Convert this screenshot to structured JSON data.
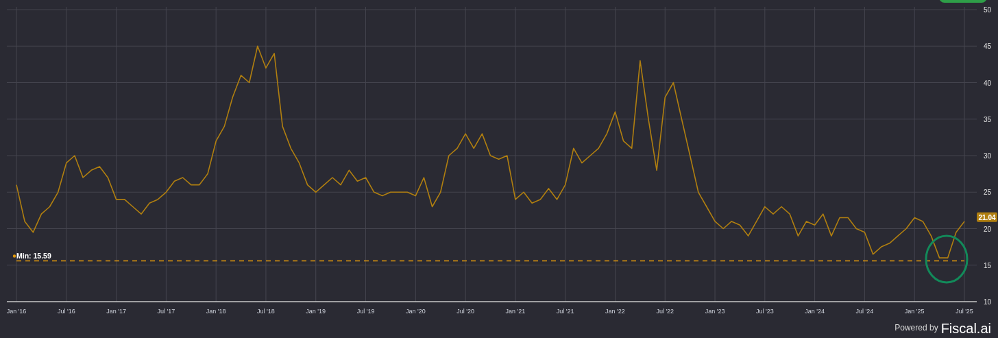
{
  "chart_data": {
    "type": "line",
    "categories": [
      "Jan '16",
      null,
      null,
      null,
      null,
      null,
      "Jul '16",
      null,
      null,
      null,
      null,
      null,
      "Jan '17",
      null,
      null,
      null,
      null,
      null,
      "Jul '17",
      null,
      null,
      null,
      null,
      null,
      "Jan '18",
      null,
      null,
      null,
      null,
      null,
      "Jul '18",
      null,
      null,
      null,
      null,
      null,
      "Jan '19",
      null,
      null,
      null,
      null,
      null,
      "Jul '19",
      null,
      null,
      null,
      null,
      null,
      "Jan '20",
      null,
      null,
      null,
      null,
      null,
      "Jul '20",
      null,
      null,
      null,
      null,
      null,
      "Jan '21",
      null,
      null,
      null,
      null,
      null,
      "Jul '21",
      null,
      null,
      null,
      null,
      null,
      "Jan '22",
      null,
      null,
      null,
      null,
      null,
      "Jul '22",
      null,
      null,
      null,
      null,
      null,
      "Jan '23",
      null,
      null,
      null,
      null,
      null,
      "Jul '23",
      null,
      null,
      null,
      null,
      null,
      "Jan '24",
      null,
      null,
      null,
      null,
      null,
      "Jul '24",
      null,
      null,
      null,
      null,
      null,
      "Jan '25",
      null,
      null,
      null,
      null,
      null,
      "Jul '25"
    ],
    "series": [
      {
        "color": "#b07f10",
        "values": [
          26,
          21,
          19.5,
          22,
          23,
          25,
          29,
          30,
          27,
          28,
          28.5,
          27,
          24,
          24,
          23,
          22,
          23.5,
          24,
          25,
          26.5,
          27,
          26,
          26,
          27.5,
          32,
          34,
          38,
          41,
          40,
          45,
          42,
          44,
          34,
          31,
          29,
          26,
          25,
          26,
          27,
          26,
          28,
          26.5,
          27,
          25,
          24.5,
          25,
          25,
          25,
          24.5,
          27,
          23,
          25,
          30,
          31,
          33,
          31,
          33,
          30,
          29.5,
          30,
          24,
          25,
          23.5,
          24,
          25.5,
          24,
          26,
          31,
          29,
          30,
          31,
          33,
          36,
          32,
          31,
          43,
          35,
          28,
          38,
          40,
          35,
          30,
          25,
          23,
          21,
          20,
          21,
          20.5,
          19,
          21,
          23,
          22,
          23,
          22,
          19,
          21,
          20.5,
          22,
          19,
          21.5,
          21.5,
          20,
          19.5,
          16.5,
          17.5,
          18,
          19,
          20,
          21.5,
          21,
          19,
          16,
          16,
          19.5,
          21
        ]
      },
      {
        "name": "Min: 15.59",
        "color": "#e0980c",
        "line_style": "dashed",
        "values": [
          15.59,
          15.59,
          15.59,
          15.59,
          15.59,
          15.59,
          15.59,
          15.59,
          15.59,
          15.59,
          15.59,
          15.59,
          15.59,
          15.59,
          15.59,
          15.59,
          15.59,
          15.59,
          15.59,
          15.59,
          15.59,
          15.59,
          15.59,
          15.59,
          15.59,
          15.59,
          15.59,
          15.59,
          15.59,
          15.59,
          15.59,
          15.59,
          15.59,
          15.59,
          15.59,
          15.59,
          15.59,
          15.59,
          15.59,
          15.59,
          15.59,
          15.59,
          15.59,
          15.59,
          15.59,
          15.59,
          15.59,
          15.59,
          15.59,
          15.59,
          15.59,
          15.59,
          15.59,
          15.59,
          15.59,
          15.59,
          15.59,
          15.59,
          15.59,
          15.59,
          15.59,
          15.59,
          15.59,
          15.59,
          15.59,
          15.59,
          15.59,
          15.59,
          15.59,
          15.59,
          15.59,
          15.59,
          15.59,
          15.59,
          15.59,
          15.59,
          15.59,
          15.59,
          15.59,
          15.59,
          15.59,
          15.59,
          15.59,
          15.59,
          15.59,
          15.59,
          15.59,
          15.59,
          15.59,
          15.59,
          15.59,
          15.59,
          15.59,
          15.59,
          15.59,
          15.59,
          15.59,
          15.59,
          15.59,
          15.59,
          15.59,
          15.59,
          15.59,
          15.59,
          15.59,
          15.59,
          15.59,
          15.59,
          15.59,
          15.59,
          15.59,
          15.59,
          15.59,
          15.59,
          15.59
        ]
      }
    ],
    "ylim": [
      10,
      50
    ],
    "yticks": [
      10,
      15,
      20,
      25,
      30,
      35,
      40,
      45,
      50
    ],
    "grid": true,
    "annotations": [
      "21.04"
    ]
  },
  "footer": {
    "prefix": "Powered by",
    "brand": "Fiscal.ai"
  }
}
